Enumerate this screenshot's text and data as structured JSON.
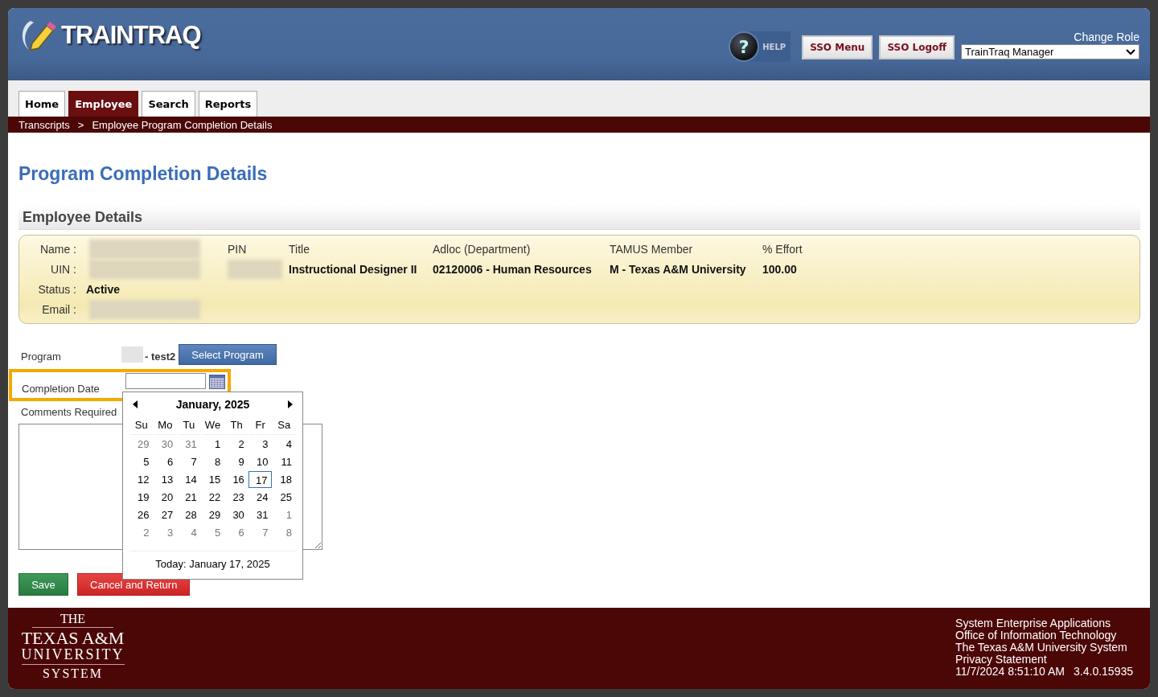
{
  "header": {
    "logo": "TRAINTRAQ",
    "help": {
      "glyph": "?",
      "label": "HELP"
    },
    "buttons": [
      "SSO Menu",
      "SSO Logoff"
    ],
    "role_label": "Change Role",
    "role_value": "TrainTraq Manager"
  },
  "tabs": [
    {
      "label": "Home",
      "selected": false
    },
    {
      "label": "Employee",
      "selected": true
    },
    {
      "label": "Search",
      "selected": false
    },
    {
      "label": "Reports",
      "selected": false
    }
  ],
  "breadcrumb": {
    "items": [
      "Transcripts",
      "Employee Program Completion Details"
    ],
    "separator": ">"
  },
  "page_title": "Program Completion Details",
  "section_title": "Employee Details",
  "employee": {
    "fields": [
      {
        "label": "Name :",
        "blurred": true
      },
      {
        "label": "UIN :",
        "blurred": true
      },
      {
        "label": "Status :",
        "value": "Active",
        "blurred": false
      },
      {
        "label": "Email :",
        "blurred": true
      }
    ],
    "columns": [
      {
        "label": "PIN",
        "blurred": true
      },
      {
        "label": "Title",
        "value": "Instructional Designer II",
        "blurred": false
      },
      {
        "label": "Adloc (Department)",
        "value": "02120006 - Human Resources",
        "blurred": false
      },
      {
        "label": "TAMUS Member",
        "value": "M - Texas A&M University",
        "blurred": false
      },
      {
        "label": "% Effort",
        "value": "100.00",
        "blurred": false
      }
    ]
  },
  "form": {
    "program_label": "Program",
    "program_value": "- test2",
    "select_button": "Select Program",
    "date_label": "Completion Date",
    "date_highlighted": true,
    "comments_label": "Comments Required"
  },
  "calendar": {
    "month": "January, 2025",
    "weekdays": [
      "Su",
      "Mo",
      "Tu",
      "We",
      "Th",
      "Fr",
      "Sa"
    ],
    "weeks": [
      [
        {
          "label": "29",
          "muted": true,
          "selected": false
        },
        {
          "label": "30",
          "muted": true,
          "selected": false
        },
        {
          "label": "31",
          "muted": true,
          "selected": false
        },
        {
          "label": "1",
          "muted": false,
          "selected": false
        },
        {
          "label": "2",
          "muted": false,
          "selected": false
        },
        {
          "label": "3",
          "muted": false,
          "selected": false
        },
        {
          "label": "4",
          "muted": false,
          "selected": false
        }
      ],
      [
        {
          "label": "5",
          "muted": false,
          "selected": false
        },
        {
          "label": "6",
          "muted": false,
          "selected": false
        },
        {
          "label": "7",
          "muted": false,
          "selected": false
        },
        {
          "label": "8",
          "muted": false,
          "selected": false
        },
        {
          "label": "9",
          "muted": false,
          "selected": false
        },
        {
          "label": "10",
          "muted": false,
          "selected": false
        },
        {
          "label": "11",
          "muted": false,
          "selected": false
        }
      ],
      [
        {
          "label": "12",
          "muted": false,
          "selected": false
        },
        {
          "label": "13",
          "muted": false,
          "selected": false
        },
        {
          "label": "14",
          "muted": false,
          "selected": false
        },
        {
          "label": "15",
          "muted": false,
          "selected": false
        },
        {
          "label": "16",
          "muted": false,
          "selected": false
        },
        {
          "label": "17",
          "muted": false,
          "selected": true
        },
        {
          "label": "18",
          "muted": false,
          "selected": false
        }
      ],
      [
        {
          "label": "19",
          "muted": false,
          "selected": false
        },
        {
          "label": "20",
          "muted": false,
          "selected": false
        },
        {
          "label": "21",
          "muted": false,
          "selected": false
        },
        {
          "label": "22",
          "muted": false,
          "selected": false
        },
        {
          "label": "23",
          "muted": false,
          "selected": false
        },
        {
          "label": "24",
          "muted": false,
          "selected": false
        },
        {
          "label": "25",
          "muted": false,
          "selected": false
        }
      ],
      [
        {
          "label": "26",
          "muted": false,
          "selected": false
        },
        {
          "label": "27",
          "muted": false,
          "selected": false
        },
        {
          "label": "28",
          "muted": false,
          "selected": false
        },
        {
          "label": "29",
          "muted": false,
          "selected": false
        },
        {
          "label": "30",
          "muted": false,
          "selected": false
        },
        {
          "label": "31",
          "muted": false,
          "selected": false
        },
        {
          "label": "1",
          "muted": true,
          "selected": false
        }
      ],
      [
        {
          "label": "2",
          "muted": true,
          "selected": false
        },
        {
          "label": "3",
          "muted": true,
          "selected": false
        },
        {
          "label": "4",
          "muted": true,
          "selected": false
        },
        {
          "label": "5",
          "muted": true,
          "selected": false
        },
        {
          "label": "6",
          "muted": true,
          "selected": false
        },
        {
          "label": "7",
          "muted": true,
          "selected": false
        },
        {
          "label": "8",
          "muted": true,
          "selected": false
        }
      ]
    ],
    "today": "Today: January 17, 2025"
  },
  "actions": [
    {
      "label": "Save",
      "kind": "primary"
    },
    {
      "label": "Cancel and Return",
      "kind": "danger"
    }
  ],
  "footer": {
    "logo_lines": [
      "THE",
      "TEXAS A&M",
      "UNIVERSITY",
      "SYSTEM"
    ],
    "lines": [
      "System Enterprise Applications",
      "Office of Information Technology",
      "The Texas A&M University System"
    ],
    "privacy_link": "Privacy Statement",
    "timestamp": "11/7/2024 8:51:10 AM",
    "version": "3.4.0.15935"
  }
}
